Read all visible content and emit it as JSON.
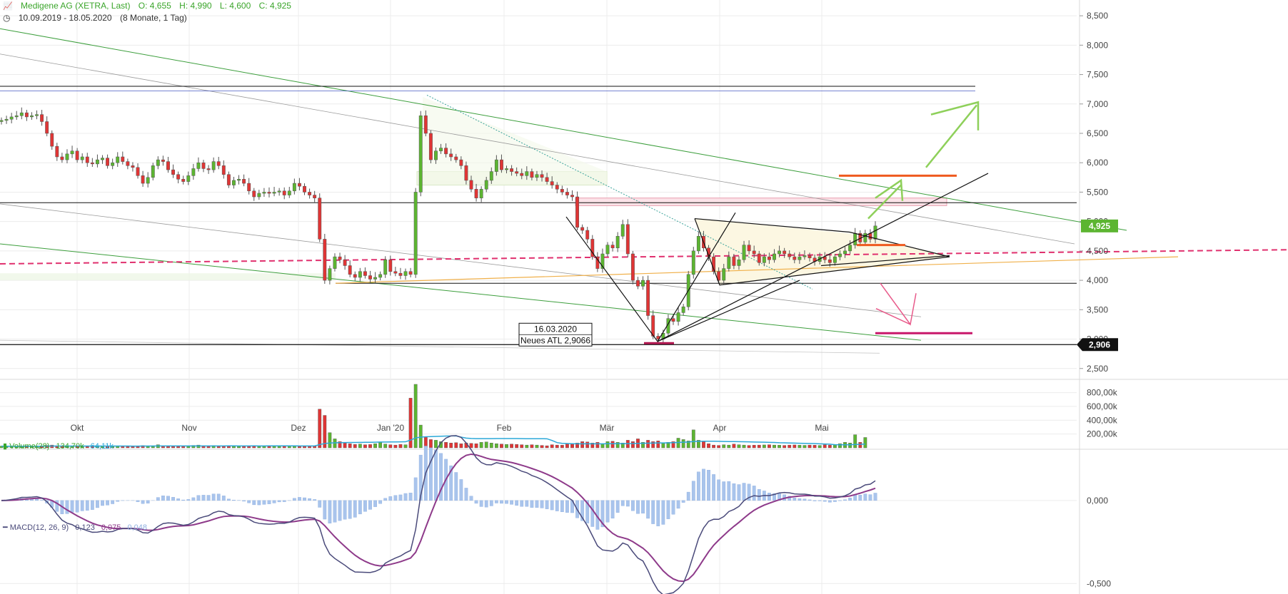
{
  "header": {
    "title": "Medigene AG (XETRA, Last)",
    "open": "O: 4,655",
    "high": "H: 4,990",
    "low": "L: 4,600",
    "close": "C: 4,925",
    "range": "10.09.2019 - 18.05.2020",
    "span": "(8 Monate, 1 Tag)"
  },
  "colors": {
    "up": "#5cb531",
    "down": "#e03535",
    "grid": "#ececec",
    "trend_green": "#3c9e3c",
    "trend_gray": "#9a9a9a",
    "pink": "#e0306e",
    "orange_line": "#f0b04a",
    "resist_orange": "#ef5a1f",
    "arrow_green": "#8ed05a",
    "volume_avg": "#2ba8d8",
    "macd_line": "#8e3a8a",
    "signal_line": "#4a4a7a",
    "macd_hist": "#a9c4ec"
  },
  "annotation": {
    "date": "16.03.2020",
    "text": "Neues ATL 2,9066"
  },
  "chart_data": [
    {
      "type": "candlestick",
      "x_tick_labels": [
        "Okt",
        "Nov",
        "Dez",
        "Jan '20",
        "Feb",
        "Mär",
        "Apr",
        "Mai"
      ],
      "y_ticks": [
        2.5,
        3.0,
        3.5,
        4.0,
        4.5,
        5.0,
        5.5,
        6.0,
        6.5,
        7.0,
        7.5,
        8.0,
        8.5
      ],
      "y_tick_labels": [
        "2,500",
        "3,000",
        "3,500",
        "4,000",
        "4,500",
        "5,000",
        "5,500",
        "6,000",
        "6,500",
        "7,000",
        "7,500",
        "8,000",
        "8,500"
      ],
      "ylim": [
        2.4,
        8.55
      ],
      "last_price_label": "4,925",
      "low_price_label": "2,906",
      "closes": [
        6.72,
        6.74,
        6.78,
        6.8,
        6.85,
        6.78,
        6.8,
        6.82,
        6.7,
        6.5,
        6.28,
        6.1,
        6.05,
        6.15,
        6.2,
        6.05,
        6.1,
        6.0,
        5.98,
        6.05,
        6.08,
        5.95,
        6.0,
        6.1,
        6.02,
        5.95,
        5.92,
        5.78,
        5.65,
        5.75,
        5.95,
        6.05,
        6.02,
        5.88,
        5.8,
        5.72,
        5.68,
        5.78,
        5.9,
        6.0,
        5.9,
        5.88,
        6.02,
        5.95,
        5.8,
        5.62,
        5.7,
        5.72,
        5.65,
        5.52,
        5.42,
        5.48,
        5.5,
        5.48,
        5.5,
        5.52,
        5.45,
        5.52,
        5.65,
        5.6,
        5.5,
        5.45,
        5.4,
        4.7,
        4.0,
        4.2,
        4.4,
        4.35,
        4.25,
        4.1,
        4.05,
        4.15,
        4.08,
        4.02,
        4.05,
        4.1,
        4.35,
        4.15,
        4.12,
        4.08,
        4.15,
        4.1,
        5.5,
        6.8,
        6.5,
        6.05,
        6.2,
        6.25,
        6.15,
        6.1,
        6.05,
        5.95,
        5.7,
        5.55,
        5.4,
        5.55,
        5.7,
        5.85,
        6.05,
        5.88,
        5.9,
        5.85,
        5.82,
        5.78,
        5.85,
        5.75,
        5.8,
        5.75,
        5.68,
        5.62,
        5.55,
        5.5,
        5.45,
        5.42,
        4.9,
        4.85,
        4.7,
        4.4,
        4.2,
        4.45,
        4.6,
        4.55,
        4.75,
        4.95,
        4.45,
        4.0,
        3.9,
        4.0,
        3.4,
        3.05,
        3.0,
        3.1,
        3.35,
        3.3,
        3.45,
        3.55,
        4.1,
        4.5,
        4.75,
        4.55,
        4.4,
        4.15,
        4.0,
        4.2,
        4.4,
        4.25,
        4.35,
        4.6,
        4.5,
        4.45,
        4.3,
        4.4,
        4.35,
        4.45,
        4.5,
        4.45,
        4.4,
        4.35,
        4.4,
        4.42,
        4.38,
        4.32,
        4.4,
        4.35,
        4.3,
        4.4,
        4.45,
        4.5,
        4.6,
        4.8,
        4.65,
        4.8,
        4.7,
        4.925
      ],
      "volumes_k": [
        25,
        22,
        18,
        20,
        24,
        30,
        18,
        22,
        28,
        35,
        40,
        30,
        28,
        25,
        22,
        26,
        24,
        20,
        22,
        30,
        28,
        25,
        22,
        26,
        24,
        22,
        20,
        28,
        32,
        26,
        30,
        45,
        28,
        24,
        22,
        26,
        24,
        28,
        35,
        40,
        30,
        28,
        32,
        28,
        26,
        30,
        24,
        22,
        28,
        26,
        24,
        22,
        26,
        24,
        28,
        30,
        26,
        30,
        32,
        28,
        24,
        26,
        28,
        560,
        470,
        220,
        130,
        90,
        70,
        60,
        50,
        55,
        45,
        48,
        60,
        80,
        55,
        45,
        40,
        50,
        45,
        720,
        920,
        330,
        160,
        120,
        110,
        90,
        80,
        70,
        75,
        60,
        70,
        65,
        60,
        80,
        85,
        70,
        60,
        55,
        50,
        55,
        50,
        45,
        40,
        45,
        40,
        35,
        30,
        45,
        40,
        38,
        60,
        55,
        70,
        90,
        85,
        70,
        80,
        60,
        90,
        95,
        80,
        70,
        110,
        90,
        130,
        80,
        110,
        90,
        100,
        70,
        80,
        90,
        140,
        120,
        100,
        260,
        110,
        90,
        60,
        40,
        35,
        45,
        40,
        55,
        45,
        40,
        35,
        38,
        40,
        42,
        45,
        40,
        38,
        35,
        40,
        42,
        38,
        36,
        40,
        38,
        35,
        45,
        40,
        50,
        60,
        80,
        70,
        190,
        80,
        150
      ],
      "horizontal_levels": [
        7.3,
        7.22,
        5.32,
        3.95,
        2.906
      ],
      "lower_pane_gap": true
    },
    {
      "type": "bar",
      "title": "Volume(28)",
      "values_label": "134,70k",
      "avg_label": "64,11k",
      "y_tick_labels": [
        "200,00k",
        "400,00k",
        "600,00k",
        "800,00k"
      ],
      "y_ticks": [
        200,
        400,
        600,
        800
      ],
      "ylim": [
        0,
        930
      ]
    },
    {
      "type": "line",
      "title": "MACD(12, 26, 9)",
      "macd_label": "0,123",
      "signal_label": "0,075",
      "hist_label": "0,048",
      "y_tick_labels": [
        "0,000",
        "-0,500"
      ],
      "y_ticks": [
        0,
        -0.5
      ],
      "ylim": [
        -0.55,
        0.3
      ]
    }
  ]
}
